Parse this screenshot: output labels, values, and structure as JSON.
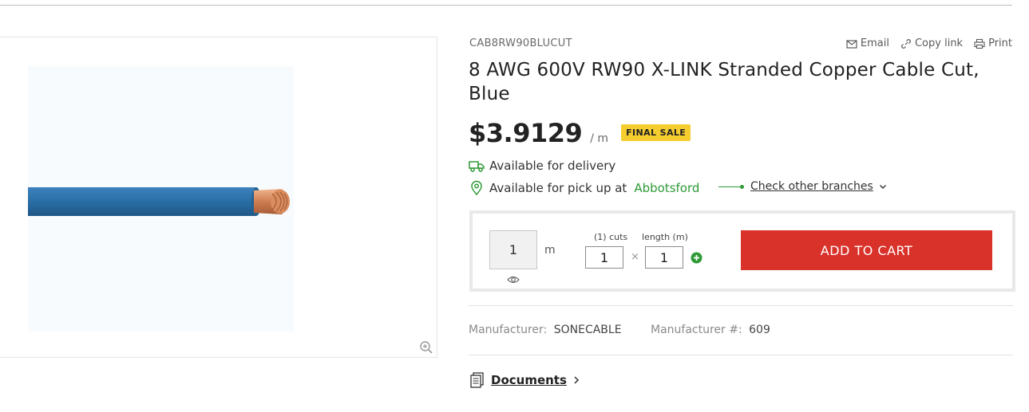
{
  "product": {
    "sku": "CAB8RW90BLUCUT",
    "title": "8 AWG 600V RW90 X-LINK Stranded Copper Cable Cut, Blue",
    "price": "$3.9129",
    "price_unit": "/ m",
    "badge": "FINAL SALE",
    "image_icon": "blue-copper-cable"
  },
  "actions": {
    "email": "Email",
    "copy_link": "Copy link",
    "print": "Print"
  },
  "availability": {
    "delivery": "Available for delivery",
    "pickup": "Available for pick up at",
    "branch": "Abbotsford",
    "check_branches": "Check other branches"
  },
  "cart": {
    "quantity": "1",
    "quantity_unit": "m",
    "cuts_label": "(1) cuts",
    "length_label": "length (m)",
    "cuts_value": "1",
    "length_value": "1",
    "times": "×",
    "add_to_cart": "ADD TO CART"
  },
  "manufacturer": {
    "name_label": "Manufacturer:",
    "name": "SONECABLE",
    "number_label": "Manufacturer #:",
    "number": "609"
  },
  "documents": {
    "label": "Documents"
  },
  "colors": {
    "accent_red": "#d9322b",
    "badge_yellow": "#f5cd2f",
    "branch_green": "#2e9a36",
    "cable_blue": "#2a6ea6",
    "copper": "#d1875a"
  }
}
